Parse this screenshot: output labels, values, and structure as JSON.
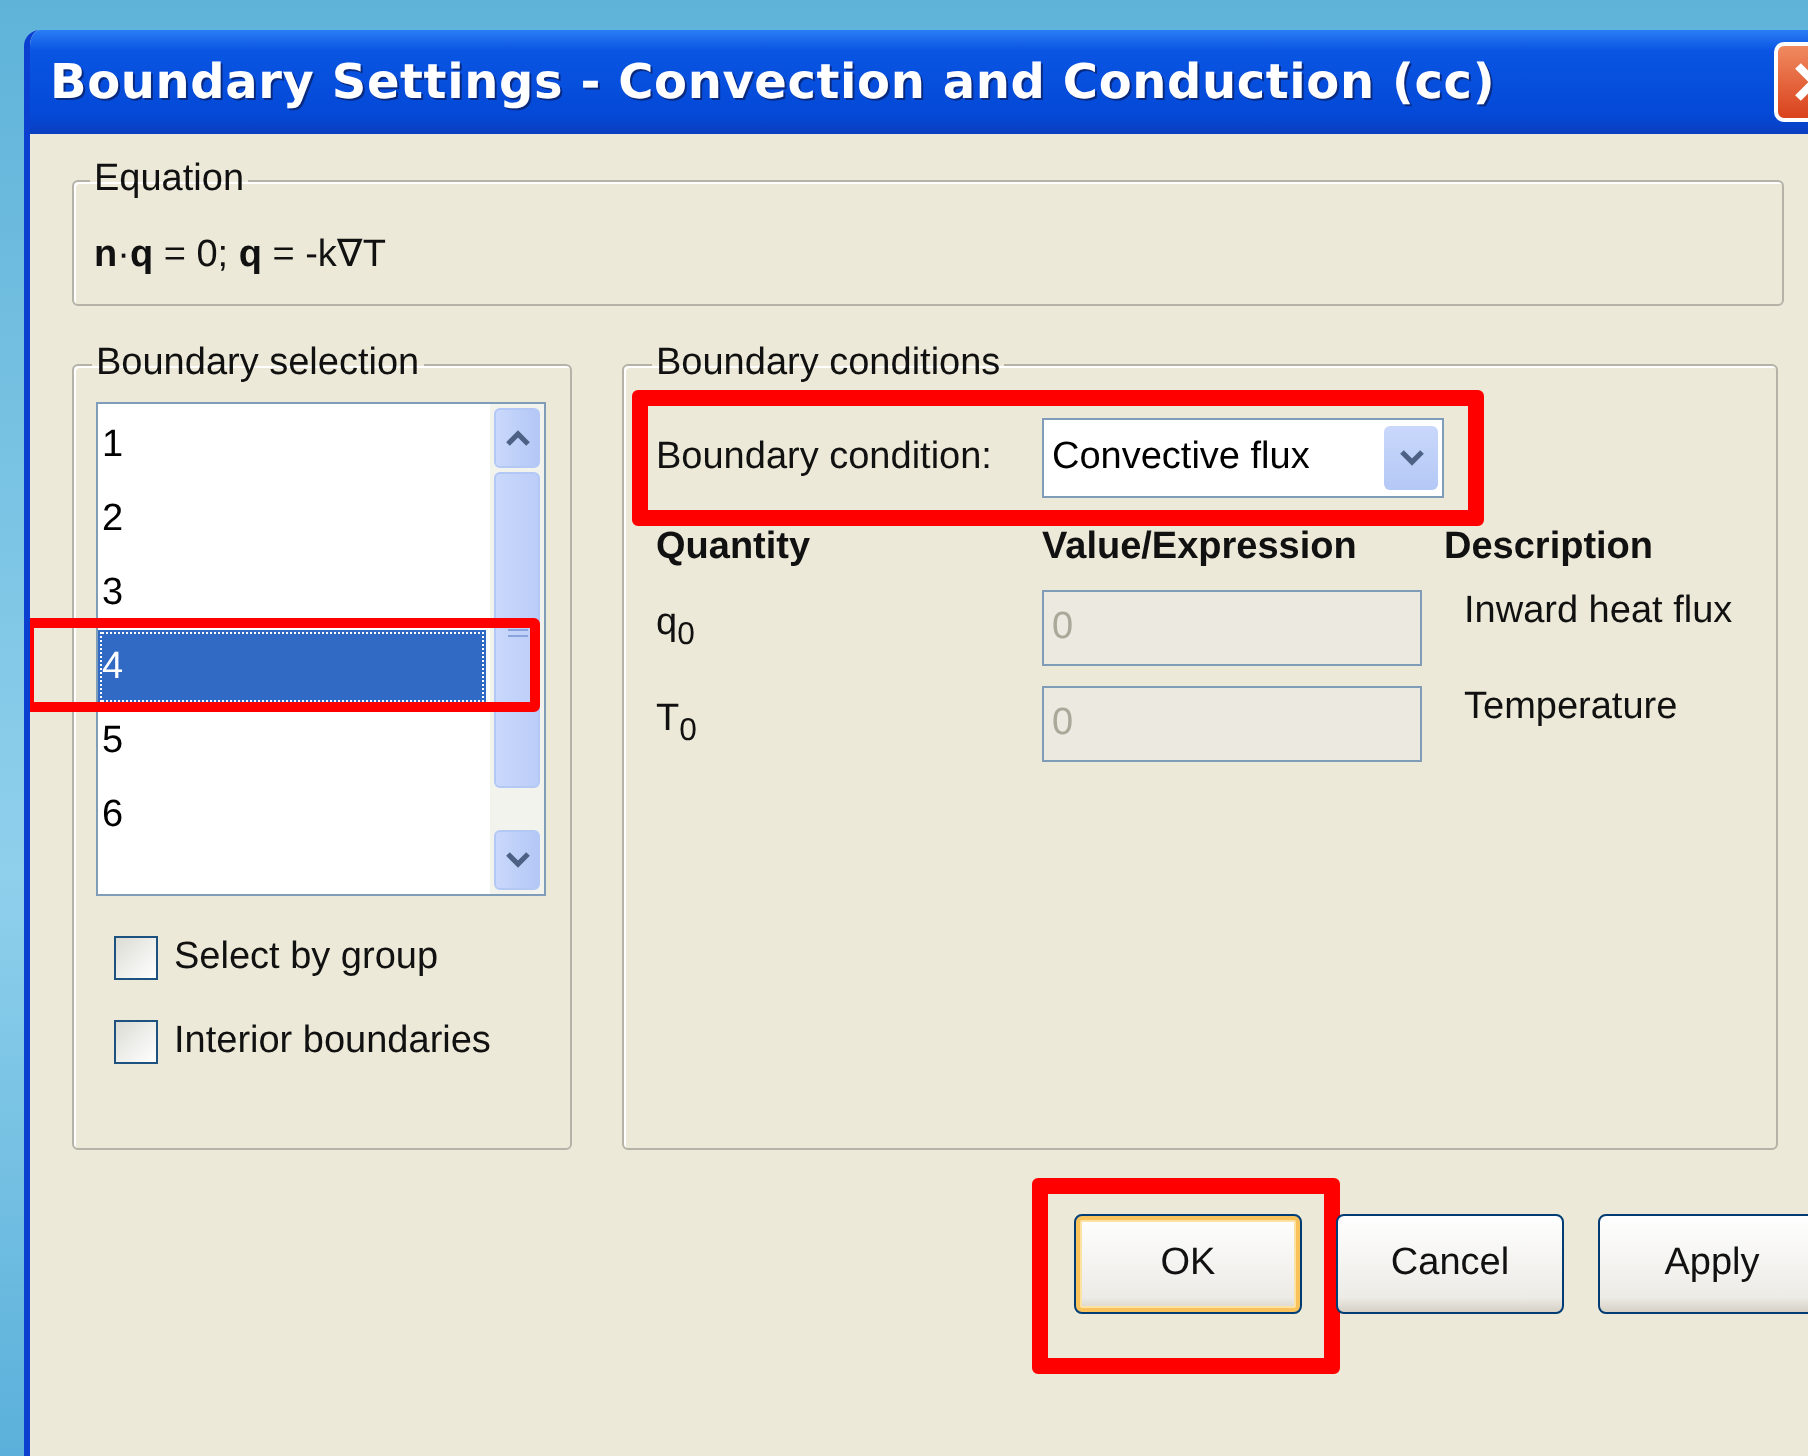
{
  "window": {
    "title": "Boundary Settings - Convection and Conduction (cc)"
  },
  "equation": {
    "label": "Equation",
    "formula": "**n**·**q** = 0; **q** = -k∇T"
  },
  "boundary_selection": {
    "label": "Boundary selection",
    "items": [
      {
        "label": "1",
        "selected": false,
        "highlighted": false
      },
      {
        "label": "2",
        "selected": false,
        "highlighted": false
      },
      {
        "label": "3",
        "selected": false,
        "highlighted": false
      },
      {
        "label": "4",
        "selected": true,
        "highlighted": true
      },
      {
        "label": "5",
        "selected": false,
        "highlighted": false
      },
      {
        "label": "6",
        "selected": false,
        "highlighted": false
      }
    ],
    "checkboxes": [
      {
        "label": "Select by group",
        "checked": false
      },
      {
        "label": "Interior boundaries",
        "checked": false
      }
    ]
  },
  "boundary_conditions": {
    "label": "Boundary conditions",
    "condition": {
      "label": "Boundary condition:",
      "value": "Convective flux",
      "highlighted": true
    },
    "columns": [
      "Quantity",
      "Value/Expression",
      "Description"
    ],
    "rows": [
      {
        "quantity": "q$_{0}$",
        "value": "0",
        "description": "Inward heat flux",
        "disabled": true
      },
      {
        "quantity": "T$_{0}$",
        "value": "0",
        "description": "Temperature",
        "disabled": true
      }
    ]
  },
  "buttons": [
    {
      "label": "OK",
      "default": true,
      "highlighted": true
    },
    {
      "label": "Cancel",
      "default": false,
      "highlighted": false
    },
    {
      "label": "Apply",
      "default": false,
      "highlighted": false
    }
  ]
}
